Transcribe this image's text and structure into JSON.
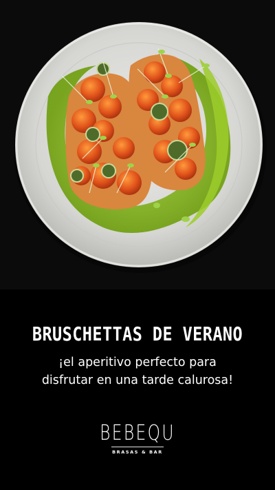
{
  "headline": "BRUSCHETTAS DE VERANO",
  "subtitle_line1": "¡el aperitivo perfecto para",
  "subtitle_line2": "disfrutar en una tarde calurosa!",
  "brand": {
    "name": "BEBEQU",
    "tagline": "BRASAS & BAR"
  },
  "colors": {
    "background": "#000000",
    "text": "#ffffff",
    "olive_oil": "#8ec21e",
    "plate": "#dcdcda"
  }
}
